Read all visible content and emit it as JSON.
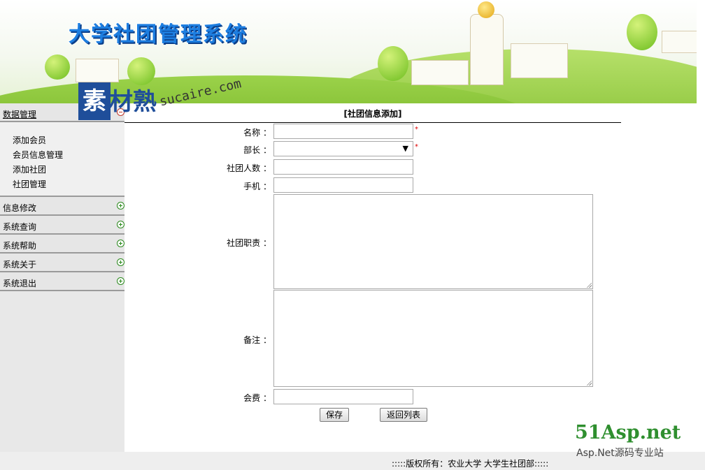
{
  "header": {
    "title": "大学社团管理系统"
  },
  "watermark": {
    "brand_cn": "素材熟",
    "domain": "sucaire.com",
    "asp_big": "51Asp.net",
    "asp_small": "Asp.Net源码专业站"
  },
  "sidebar": {
    "sections": [
      {
        "label": "数据管理",
        "state": "expanded",
        "items": [
          "添加会员",
          "会员信息管理",
          "添加社团",
          "社团管理"
        ]
      },
      {
        "label": "信息修改",
        "state": "collapsed"
      },
      {
        "label": "系统查询",
        "state": "collapsed"
      },
      {
        "label": "系统帮助",
        "state": "collapsed"
      },
      {
        "label": "系统关于",
        "state": "collapsed"
      },
      {
        "label": "系统退出",
        "state": "collapsed"
      }
    ]
  },
  "form": {
    "title": "[社团信息添加]",
    "fields": {
      "name": {
        "label": "名称 ：",
        "value": "",
        "required_mark": "*"
      },
      "minister": {
        "label": "部长 ：",
        "value": "",
        "required_mark": "*"
      },
      "member_count": {
        "label": "社团人数 ：",
        "value": ""
      },
      "phone": {
        "label": "手机 ：",
        "value": ""
      },
      "duty": {
        "label": "社团职责 ：",
        "value": ""
      },
      "remark": {
        "label": "备注 ：",
        "value": ""
      },
      "fee": {
        "label": "会费 ：",
        "value": ""
      }
    },
    "buttons": {
      "save": "保存",
      "back": "返回列表"
    }
  },
  "footer": {
    "copyright": ":::::版权所有：农业大学 大学生社团部:::::"
  },
  "colors": {
    "title_blue": "#1d7ee0",
    "required_red": "#dd0000",
    "plus_green": "#2c8a1e",
    "minus_red": "#c0392b"
  }
}
